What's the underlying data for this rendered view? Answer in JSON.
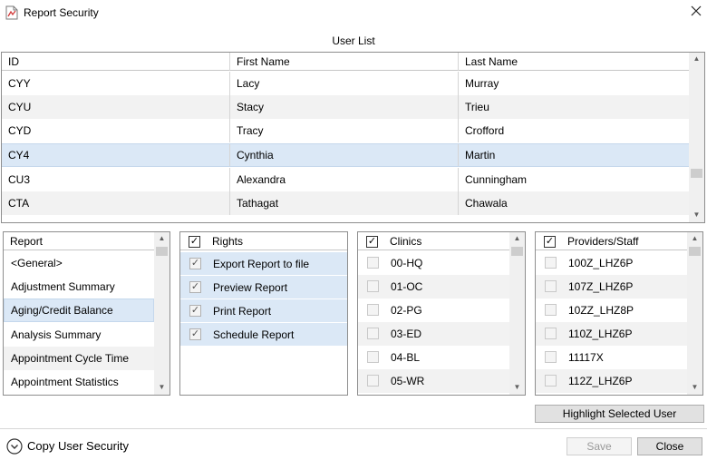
{
  "window": {
    "title": "Report Security"
  },
  "user_list": {
    "label": "User List",
    "columns": [
      "ID",
      "First Name",
      "Last Name"
    ],
    "rows": [
      {
        "id": "CYY",
        "first": "Lacy",
        "last": "Murray"
      },
      {
        "id": "CYU",
        "first": "Stacy",
        "last": "Trieu"
      },
      {
        "id": "CYD",
        "first": "Tracy",
        "last": "Crofford"
      },
      {
        "id": "CY4",
        "first": "Cynthia",
        "last": "Martin"
      },
      {
        "id": "CU3",
        "first": "Alexandra",
        "last": "Cunningham"
      },
      {
        "id": "CTA",
        "first": "Tathagat",
        "last": "Chawala"
      }
    ],
    "selected_index": 3
  },
  "report_panel": {
    "header": "Report",
    "items": [
      "<General>",
      "Adjustment Summary",
      "Aging/Credit Balance",
      "Analysis Summary",
      "Appointment Cycle Time",
      "Appointment Statistics"
    ],
    "selected_index": 2
  },
  "rights_panel": {
    "header": "Rights",
    "header_checked": true,
    "items": [
      {
        "label": "Export Report to file",
        "checked": true
      },
      {
        "label": "Preview Report",
        "checked": true
      },
      {
        "label": "Print Report",
        "checked": true
      },
      {
        "label": "Schedule Report",
        "checked": true
      }
    ]
  },
  "clinics_panel": {
    "header": "Clinics",
    "header_checked": true,
    "items": [
      "00-HQ",
      "01-OC",
      "02-PG",
      "03-ED",
      "04-BL",
      "05-WR"
    ]
  },
  "providers_panel": {
    "header": "Providers/Staff",
    "header_checked": true,
    "items": [
      "100Z_LHZ6P",
      "107Z_LHZ6P",
      "10ZZ_LHZ8P",
      "110Z_LHZ6P",
      "11117X",
      "112Z_LHZ6P"
    ]
  },
  "buttons": {
    "highlight": "Highlight Selected User",
    "copy_user_security": "Copy User Security",
    "save": "Save",
    "close": "Close"
  },
  "colors": {
    "selection": "#dbe8f6",
    "alt_row": "#f2f2f2",
    "button_face": "#e1e1e1",
    "border": "#8e8e8e"
  }
}
